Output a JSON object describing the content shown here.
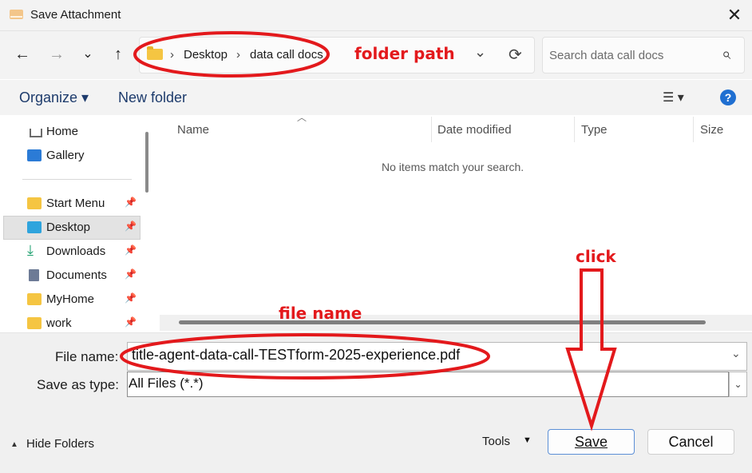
{
  "window": {
    "title": "Save Attachment",
    "close": "✕"
  },
  "nav": {
    "back": "←",
    "forward": "→",
    "recent": "⌄",
    "up": "↑"
  },
  "address": {
    "crumb_sep": "›",
    "crumbs": [
      "Desktop",
      "data call docs"
    ],
    "dropdown": "⌄",
    "refresh": "⟳"
  },
  "search": {
    "placeholder": "Search data call docs",
    "icon": "⌕"
  },
  "commands": {
    "organize": "Organize ▾",
    "new_folder": "New folder",
    "view": "☰ ▾",
    "help": "?"
  },
  "sidebar": {
    "items": [
      {
        "label": "Home",
        "icon": "home-icon"
      },
      {
        "label": "Gallery",
        "icon": "gallery-icon"
      },
      {
        "label": "Start Menu",
        "icon": "folder-icon",
        "pinned": true
      },
      {
        "label": "Desktop",
        "icon": "desktop-icon",
        "pinned": true,
        "selected": true
      },
      {
        "label": "Downloads",
        "icon": "download-icon",
        "pinned": true
      },
      {
        "label": "Documents",
        "icon": "document-icon",
        "pinned": true
      },
      {
        "label": "MyHome",
        "icon": "folder-icon",
        "pinned": true
      },
      {
        "label": "work",
        "icon": "folder-icon",
        "pinned": true
      }
    ]
  },
  "table": {
    "columns": [
      "Name",
      "Date modified",
      "Type",
      "Size"
    ],
    "empty_message": "No items match your search."
  },
  "form": {
    "file_name_label": "File name:",
    "file_name_value": "title-agent-data-call-TESTform-2025-experience.pdf",
    "save_type_label": "Save as type:",
    "save_type_value": "All Files (*.*)"
  },
  "footer": {
    "hide_folders": "Hide Folders",
    "tools": "Tools",
    "save": "Save",
    "cancel": "Cancel"
  },
  "annotations": {
    "folder_path": "folder path",
    "file_name": "file name",
    "click": "click",
    "color": "#e3191c"
  }
}
